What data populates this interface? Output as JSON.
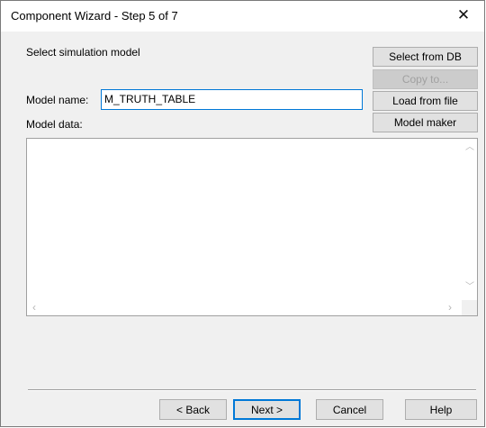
{
  "window": {
    "title": "Component Wizard - Step 5 of 7"
  },
  "labels": {
    "heading": "Select simulation model",
    "model_name": "Model name:",
    "model_data": "Model data:"
  },
  "model_name_value": "M_TRUTH_TABLE",
  "side_buttons": {
    "select_db": "Select from DB",
    "copy_to": "Copy to...",
    "load_file": "Load from file",
    "model_maker": "Model maker"
  },
  "footer_buttons": {
    "back": "< Back",
    "next": "Next >",
    "cancel": "Cancel",
    "help": "Help"
  },
  "icons": {
    "close": "close-icon",
    "scroll_up": "chevron-up-icon",
    "scroll_down": "chevron-down-icon",
    "scroll_left": "chevron-left-icon",
    "scroll_right": "chevron-right-icon"
  },
  "colors": {
    "accent": "#0078d7",
    "dialog_bg": "#f0f0f0"
  }
}
